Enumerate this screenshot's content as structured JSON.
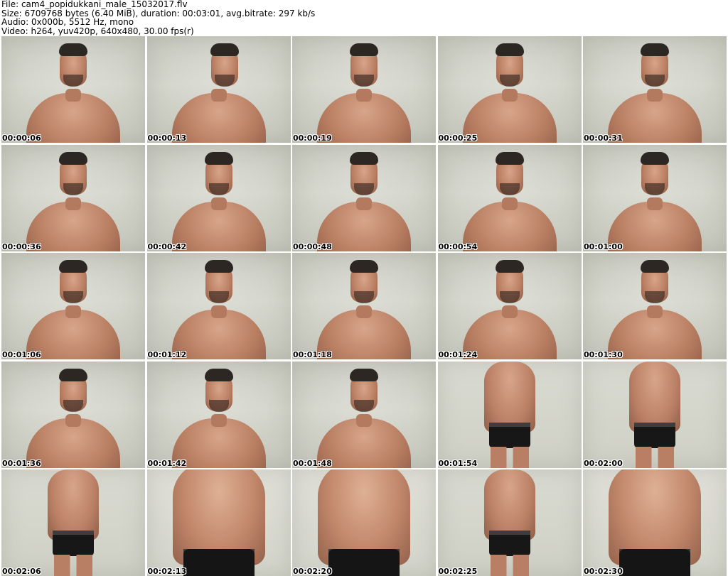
{
  "header": {
    "file_line": "File: cam4_popidukkani_male_15032017.flv",
    "size_line": "Size: 6709768 bytes (6.40 MiB), duration: 00:03:01, avg.bitrate: 297 kb/s",
    "audio_line": "Audio: 0x000b, 5512 Hz, mono",
    "video_line": "Video: h264, yuv420p, 640x480, 30.00 fps(r)"
  },
  "thumbnails": [
    {
      "timestamp": "00:00:06",
      "scene": "close-up"
    },
    {
      "timestamp": "00:00:13",
      "scene": "close-up-turned"
    },
    {
      "timestamp": "00:00:19",
      "scene": "close-up"
    },
    {
      "timestamp": "00:00:25",
      "scene": "close-up"
    },
    {
      "timestamp": "00:00:31",
      "scene": "close-up"
    },
    {
      "timestamp": "00:00:36",
      "scene": "close-up"
    },
    {
      "timestamp": "00:00:42",
      "scene": "close-up"
    },
    {
      "timestamp": "00:00:48",
      "scene": "close-up"
    },
    {
      "timestamp": "00:00:54",
      "scene": "close-up"
    },
    {
      "timestamp": "00:01:00",
      "scene": "close-up"
    },
    {
      "timestamp": "00:01:06",
      "scene": "close-up"
    },
    {
      "timestamp": "00:01:12",
      "scene": "close-up"
    },
    {
      "timestamp": "00:01:18",
      "scene": "close-up"
    },
    {
      "timestamp": "00:01:24",
      "scene": "close-up"
    },
    {
      "timestamp": "00:01:30",
      "scene": "close-up"
    },
    {
      "timestamp": "00:01:36",
      "scene": "close-up"
    },
    {
      "timestamp": "00:01:42",
      "scene": "close-up"
    },
    {
      "timestamp": "00:01:48",
      "scene": "close-up"
    },
    {
      "timestamp": "00:01:54",
      "scene": "full-body"
    },
    {
      "timestamp": "00:02:00",
      "scene": "full-body"
    },
    {
      "timestamp": "00:02:06",
      "scene": "full-body"
    },
    {
      "timestamp": "00:02:13",
      "scene": "torso-close"
    },
    {
      "timestamp": "00:02:20",
      "scene": "torso-close"
    },
    {
      "timestamp": "00:02:25",
      "scene": "full-body"
    },
    {
      "timestamp": "00:02:30",
      "scene": "torso-close"
    }
  ]
}
